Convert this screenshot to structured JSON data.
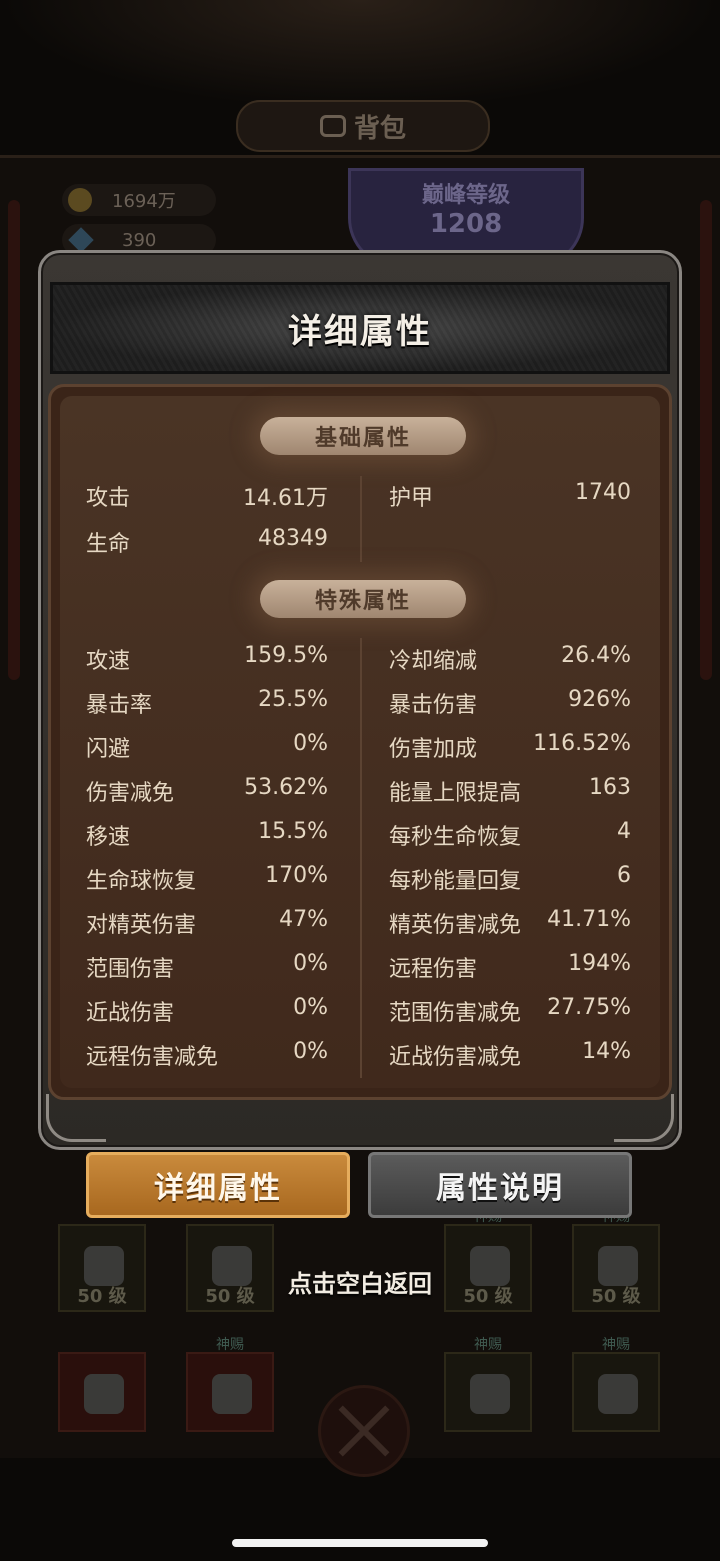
{
  "background": {
    "title": "背包",
    "gold": "1694万",
    "gems": "390",
    "peak_label": "巅峰等级",
    "peak_level": "1208",
    "item_level_label": "50 级",
    "item_tag": "神赐"
  },
  "modal": {
    "title": "详细属性",
    "basic_section": "基础属性",
    "special_section": "特殊属性",
    "basic_stats": [
      {
        "name": "攻击",
        "value": "14.61万"
      },
      {
        "name": "护甲",
        "value": "1740"
      },
      {
        "name": "生命",
        "value": "48349"
      }
    ],
    "special_left": [
      {
        "name": "攻速",
        "value": "159.5%"
      },
      {
        "name": "暴击率",
        "value": "25.5%"
      },
      {
        "name": "闪避",
        "value": "0%"
      },
      {
        "name": "伤害减免",
        "value": "53.62%"
      },
      {
        "name": "移速",
        "value": "15.5%"
      },
      {
        "name": "生命球恢复",
        "value": "170%"
      },
      {
        "name": "对精英伤害",
        "value": "47%"
      },
      {
        "name": "范围伤害",
        "value": "0%"
      },
      {
        "name": "近战伤害",
        "value": "0%"
      },
      {
        "name": "远程伤害减免",
        "value": "0%"
      }
    ],
    "special_right": [
      {
        "name": "冷却缩减",
        "value": "26.4%"
      },
      {
        "name": "暴击伤害",
        "value": "926%"
      },
      {
        "name": "伤害加成",
        "value": "116.52%"
      },
      {
        "name": "能量上限提高",
        "value": "163"
      },
      {
        "name": "每秒生命恢复",
        "value": "4"
      },
      {
        "name": "每秒能量回复",
        "value": "6"
      },
      {
        "name": "精英伤害减免",
        "value": "41.71%"
      },
      {
        "name": "远程伤害",
        "value": "194%"
      },
      {
        "name": "范围伤害减免",
        "value": "27.75%"
      },
      {
        "name": "近战伤害减免",
        "value": "14%"
      }
    ]
  },
  "tabs": {
    "detail": "详细属性",
    "explain": "属性说明"
  },
  "hint": "点击空白返回",
  "colors": {
    "accent_tab": "#c98a3c",
    "panel_brown": "#40291c",
    "pill": "#b49a82"
  }
}
